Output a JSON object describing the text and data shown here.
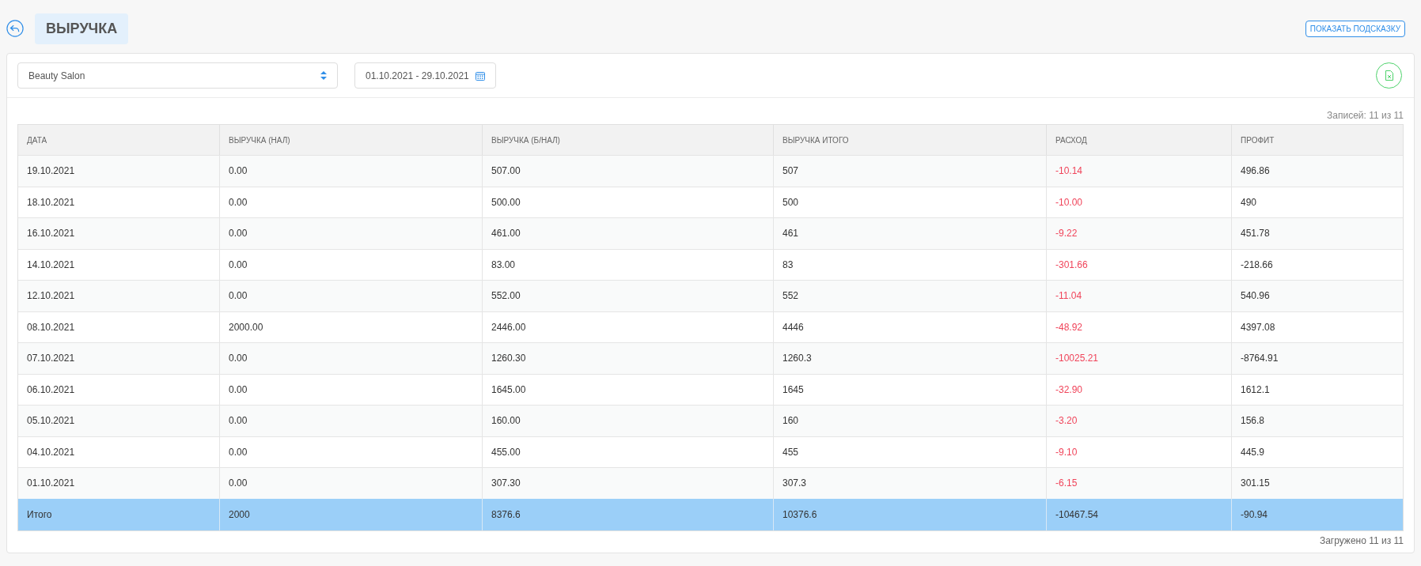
{
  "page": {
    "title": "ВЫРУЧКА",
    "hint_button": "ПОКАЗАТЬ ПОДСКАЗКУ"
  },
  "filters": {
    "salon": "Beauty Salon",
    "date_range": "01.10.2021 - 29.10.2021"
  },
  "records_count": "Записей: 11 из 11",
  "table": {
    "columns": [
      {
        "label": "ДАТА",
        "kind": "normal"
      },
      {
        "label": "ВЫРУЧКА (НАЛ)",
        "kind": "normal"
      },
      {
        "label": "ВЫРУЧКА (Б/НАЛ)",
        "kind": "normal"
      },
      {
        "label": "ВЫРУЧКА ИТОГО",
        "kind": "normal"
      },
      {
        "label": "РАСХОД",
        "kind": "negative"
      },
      {
        "label": "ПРОФИТ",
        "kind": "normal"
      }
    ],
    "rows": [
      [
        "19.10.2021",
        "0.00",
        "507.00",
        "507",
        "-10.14",
        "496.86"
      ],
      [
        "18.10.2021",
        "0.00",
        "500.00",
        "500",
        "-10.00",
        "490"
      ],
      [
        "16.10.2021",
        "0.00",
        "461.00",
        "461",
        "-9.22",
        "451.78"
      ],
      [
        "14.10.2021",
        "0.00",
        "83.00",
        "83",
        "-301.66",
        "-218.66"
      ],
      [
        "12.10.2021",
        "0.00",
        "552.00",
        "552",
        "-11.04",
        "540.96"
      ],
      [
        "08.10.2021",
        "2000.00",
        "2446.00",
        "4446",
        "-48.92",
        "4397.08"
      ],
      [
        "07.10.2021",
        "0.00",
        "1260.30",
        "1260.3",
        "-10025.21",
        "-8764.91"
      ],
      [
        "06.10.2021",
        "0.00",
        "1645.00",
        "1645",
        "-32.90",
        "1612.1"
      ],
      [
        "05.10.2021",
        "0.00",
        "160.00",
        "160",
        "-3.20",
        "156.8"
      ],
      [
        "04.10.2021",
        "0.00",
        "455.00",
        "455",
        "-9.10",
        "445.9"
      ],
      [
        "01.10.2021",
        "0.00",
        "307.30",
        "307.3",
        "-6.15",
        "301.15"
      ]
    ],
    "total": [
      "Итого",
      "2000",
      "8376.6",
      "10376.6",
      "-10467.54",
      "-90.94"
    ]
  },
  "loaded_count": "Загружено 11 из 11"
}
